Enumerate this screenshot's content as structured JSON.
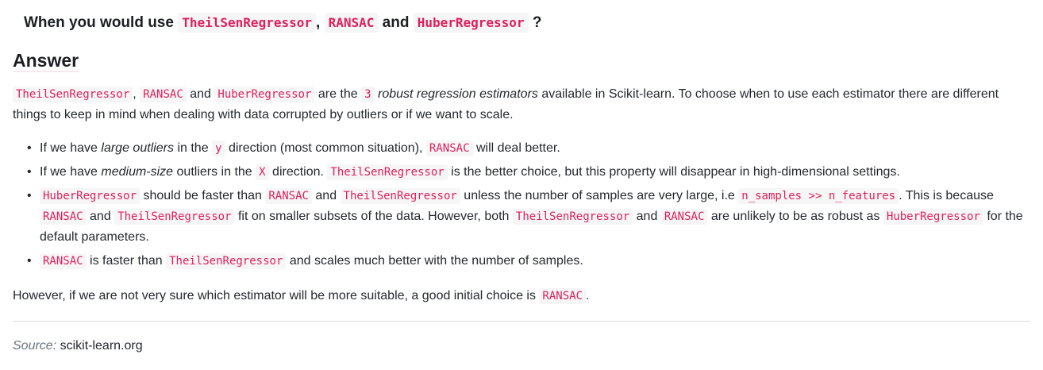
{
  "question": {
    "prefix": "When you would use",
    "term_1": "TheilSenRegressor",
    "sep_1": ",",
    "term_2": "RANSAC",
    "and": "and",
    "term_3": "HuberRegressor",
    "suffix": "?"
  },
  "answer_heading": "Answer",
  "intro": {
    "term_1": "TheilSenRegressor",
    "sep_1": ",",
    "term_2": "RANSAC",
    "and": "and",
    "term_3": "HuberRegressor",
    "t1": "are the",
    "count": "3",
    "emphasis": "robust regression estimators",
    "t2": "available in Scikit-learn. To choose when to use each estimator there are different things to keep in mind when dealing with data corrupted by outliers or if we want to scale."
  },
  "points": {
    "bullet": "•",
    "p1": {
      "t1": "If we have",
      "em": "large outliers",
      "t2": "in the",
      "code_1": "y",
      "t3": "direction (most common situation),",
      "code_2": "RANSAC",
      "t4": "will deal better."
    },
    "p2": {
      "t1": "If we have",
      "em": "medium-size",
      "t2": "outliers in the",
      "code_1": "X",
      "t3": "direction.",
      "code_2": "TheilSenRegressor",
      "t4": "is the better choice, but this property will disappear in high-dimensional settings."
    },
    "p3": {
      "code_1": "HuberRegressor",
      "t1": "should be faster than",
      "code_2": "RANSAC",
      "t2": "and",
      "code_3": "TheilSenRegressor",
      "t3": "unless the number of samples are very large, i.e",
      "code_4": "n_samples >> n_features",
      "t4": ". This is because",
      "code_5": "RANSAC",
      "t5": "and",
      "code_6": "TheilSenRegressor",
      "t6": "fit on smaller subsets of the data. However, both",
      "code_7": "TheilSenRegressor",
      "t7": "and",
      "code_8": "RANSAC",
      "t8": "are unlikely to be as robust as",
      "code_9": "HuberRegressor",
      "t9": "for the default parameters."
    },
    "p4": {
      "code_1": "RANSAC",
      "t1": "is faster than",
      "code_2": "TheilSenRegressor",
      "t2": "and scales much better with the number of samples."
    }
  },
  "conclusion": {
    "t1": "However, if we are not very sure which estimator will be more suitable, a good initial choice is",
    "code_1": "RANSAC",
    "t2": "."
  },
  "source": {
    "label": "Source:",
    "value": "scikit-learn.org"
  }
}
